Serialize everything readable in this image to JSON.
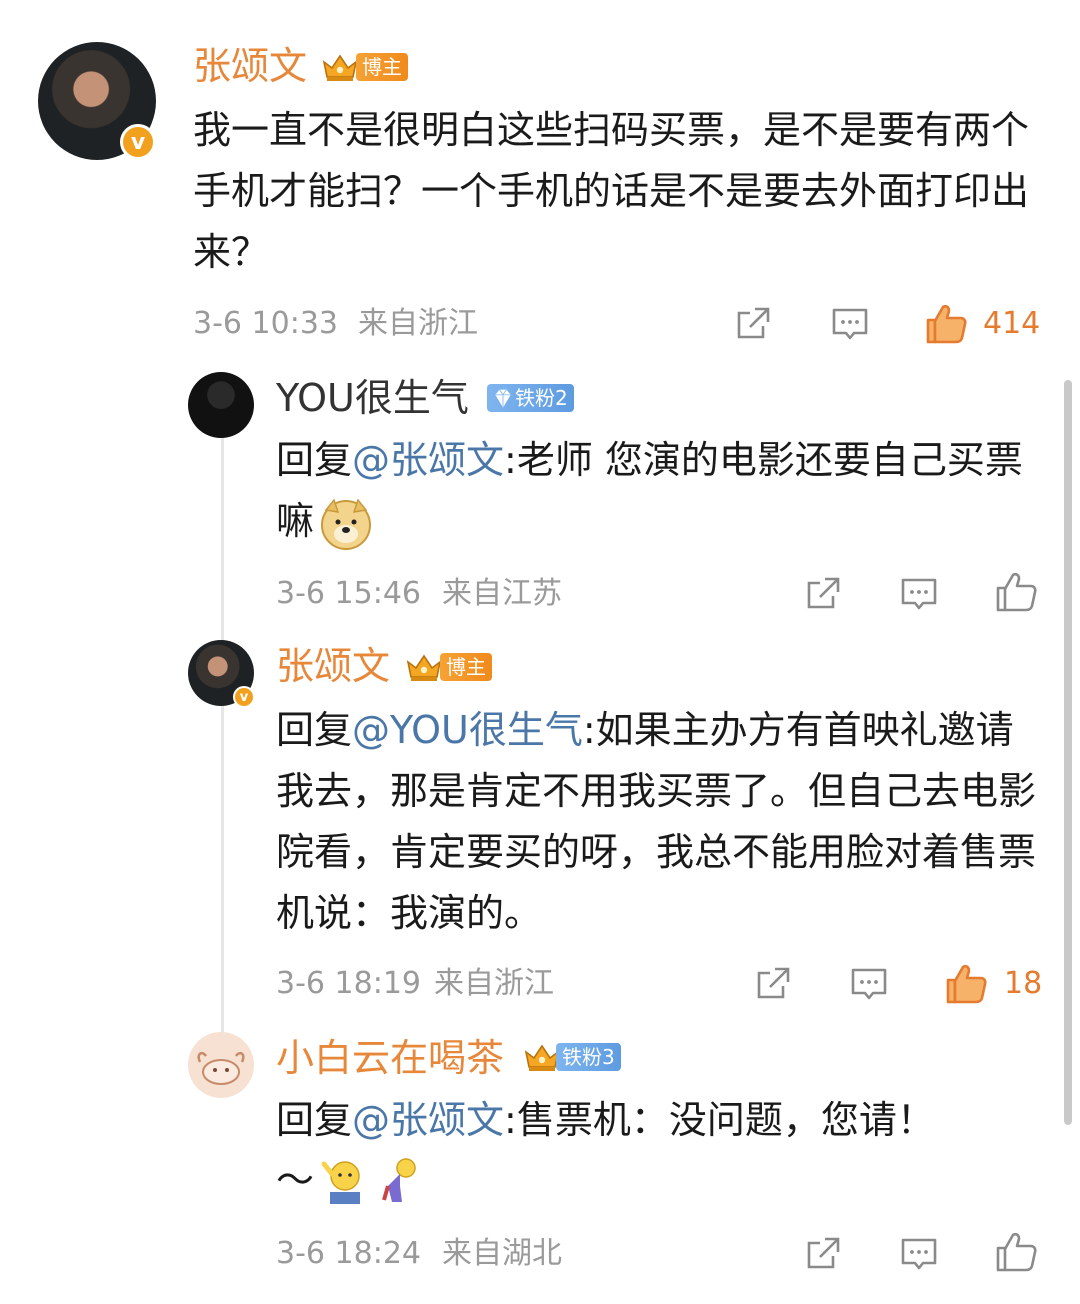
{
  "post": {
    "author": "张颂文",
    "badge": "博主",
    "text": "我一直不是很明白这些扫码买票，是不是要有两个手机才能扫？一个手机的话是不是要去外面打印出来？",
    "time": "3-6 10:33",
    "location": "来自浙江",
    "likes": "414"
  },
  "replies": [
    {
      "author": "YOU很生气",
      "badge": "铁粉2",
      "prefix": "回复",
      "mention": "@张颂文",
      "text": ":老师 您演的电影还要自己买票嘛",
      "time": "3-6 15:46",
      "location": "来自江苏",
      "emoji_name": "doge-emoji"
    },
    {
      "author": "张颂文",
      "badge": "博主",
      "prefix": "回复",
      "mention": "@YOU很生气",
      "text": ":如果主办方有首映礼邀请我去，那是肯定不用我买票了。但自己去电影院看，肯定要买的呀，我总不能用脸对着售票机说：我演的。",
      "time": "3-6 18:19",
      "location": "来自浙江",
      "likes": "18"
    },
    {
      "author": "小白云在喝茶",
      "badge": "铁粉3",
      "prefix": "回复",
      "mention": "@张颂文",
      "text": ":售票机：没问题，您请！",
      "line2": "～",
      "time": "3-6 18:24",
      "location": "来自湖北",
      "emoji_names": [
        "salute-emoji",
        "bow-emoji"
      ]
    }
  ],
  "colors": {
    "name": "#e7873a",
    "mention": "#4a77a8",
    "meta": "#9a9a9a",
    "liked": "#e47b2e",
    "icon": "#8a8a8a",
    "vip_badge": "#f5a623",
    "fan_badge": "#6fa8e8"
  }
}
